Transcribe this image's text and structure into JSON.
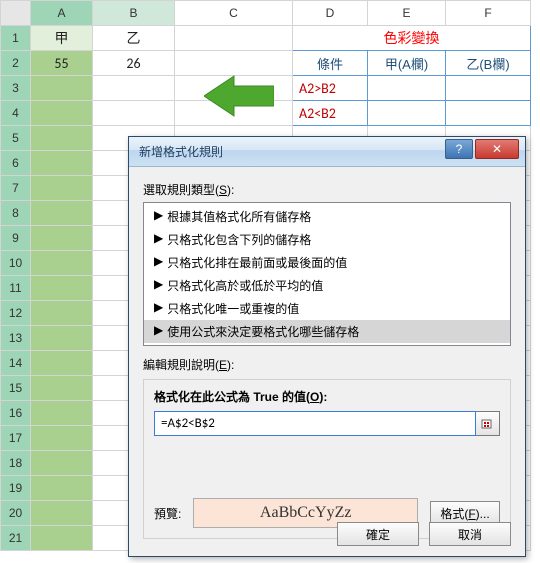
{
  "columns": [
    "A",
    "B",
    "C",
    "D",
    "E",
    "F"
  ],
  "rows": [
    "1",
    "2",
    "3",
    "4",
    "5",
    "6",
    "7",
    "8",
    "9",
    "10",
    "11",
    "12",
    "13",
    "14",
    "15",
    "16",
    "17",
    "18",
    "19",
    "20",
    "21"
  ],
  "cells": {
    "A1": "甲",
    "B1": "乙",
    "A2": "55",
    "B2": "26"
  },
  "palette_table": {
    "title": "色彩變換",
    "headers": {
      "cond": "條件",
      "colA": "甲(A欄)",
      "colB": "乙(B欄)"
    },
    "rows": [
      {
        "cond": "A2>B2"
      },
      {
        "cond": "A2<B2"
      }
    ]
  },
  "dialog": {
    "title": "新增格式化規則",
    "help_icon": "?",
    "close_icon": "✕",
    "rule_type_label_pre": "選取規則類型(",
    "rule_type_label_key": "S",
    "rule_type_label_post": "):",
    "rule_types": [
      "根據其值格式化所有儲存格",
      "只格式化包含下列的儲存格",
      "只格式化排在最前面或最後面的值",
      "只格式化高於或低於平均的值",
      "只格式化唯一或重複的值",
      "使用公式來決定要格式化哪些儲存格"
    ],
    "selected_rule_index": 5,
    "edit_label_pre": "編輯規則說明(",
    "edit_label_key": "E",
    "edit_label_post": "):",
    "formula_label_pre": "格式化在此公式為 True 的值(",
    "formula_label_key": "O",
    "formula_label_post": "):",
    "formula_value": "=A$2<B$2",
    "preview_label": "預覽:",
    "preview_sample": "AaBbCcYyZz",
    "format_button_pre": "格式(",
    "format_button_key": "F",
    "format_button_post": ")...",
    "ok": "確定",
    "cancel": "取消"
  }
}
